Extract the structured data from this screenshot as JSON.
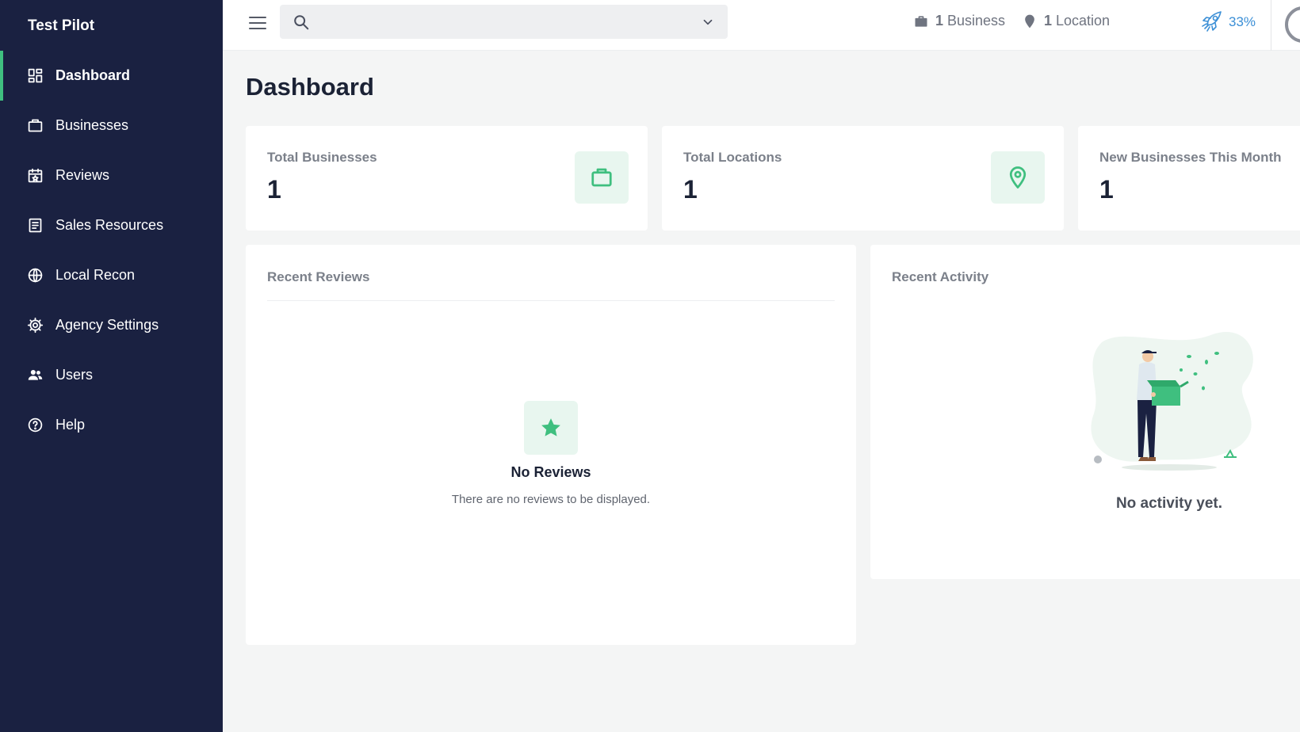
{
  "sidebar": {
    "brand": "Test Pilot",
    "items": [
      {
        "label": "Dashboard",
        "icon": "dashboard-icon",
        "active": true
      },
      {
        "label": "Businesses",
        "icon": "briefcase-icon"
      },
      {
        "label": "Reviews",
        "icon": "calendar-star-icon"
      },
      {
        "label": "Sales Resources",
        "icon": "document-icon"
      },
      {
        "label": "Local Recon",
        "icon": "globe-icon"
      },
      {
        "label": "Agency Settings",
        "icon": "gear-icon"
      },
      {
        "label": "Users",
        "icon": "users-icon"
      },
      {
        "label": "Help",
        "icon": "help-icon"
      }
    ],
    "active_accent": "#3fbf7f",
    "background": "#1a2141"
  },
  "topbar": {
    "search": {
      "value": "",
      "placeholder": ""
    },
    "business_count": "1",
    "business_label": "Business",
    "location_count": "1",
    "location_label": "Location",
    "progress": "33%",
    "progress_color": "#3b8fd6"
  },
  "main": {
    "title": "Dashboard",
    "stats": [
      {
        "label": "Total Businesses",
        "value": "1",
        "icon": "briefcase-icon"
      },
      {
        "label": "Total Locations",
        "value": "1",
        "icon": "map-pin-icon"
      },
      {
        "label": "New Businesses This Month",
        "value": "1"
      }
    ],
    "recent_reviews": {
      "title": "Recent Reviews",
      "empty_title": "No Reviews",
      "empty_text": "There are no reviews to be displayed.",
      "icon": "star-icon"
    },
    "recent_activity": {
      "title": "Recent Activity",
      "empty_text": "No activity yet."
    }
  }
}
